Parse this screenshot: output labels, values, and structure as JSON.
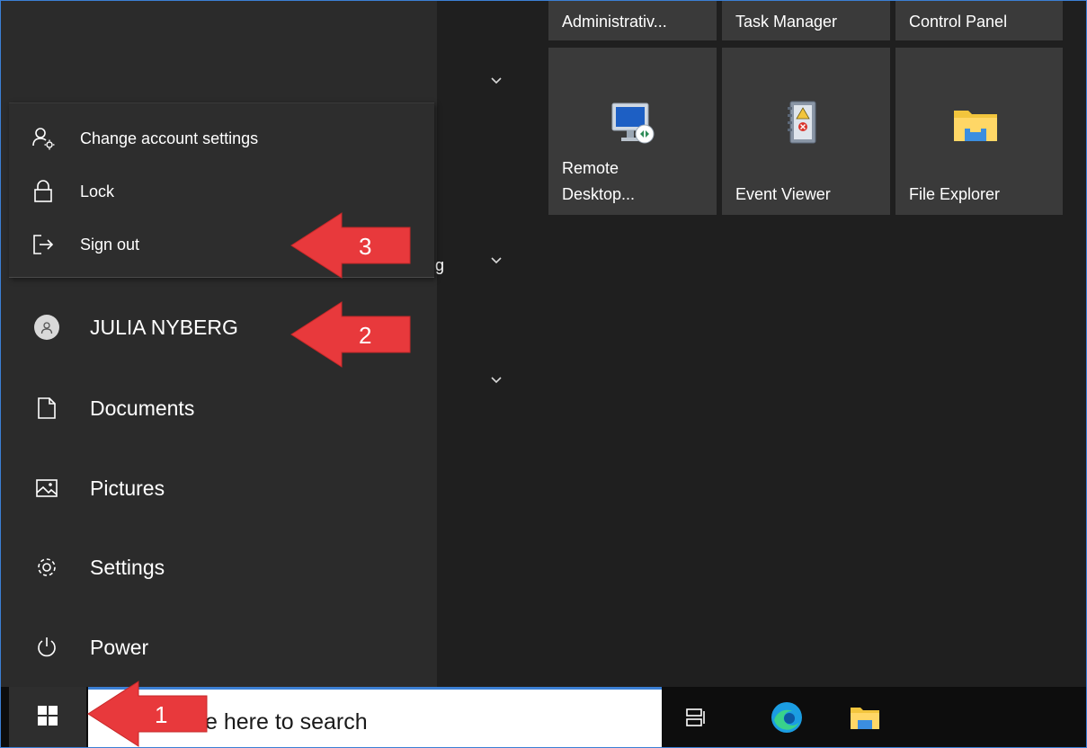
{
  "tiles": [
    {
      "label": "Administrativ...",
      "icon": "admin-tools-icon"
    },
    {
      "label": "Task Manager",
      "icon": "task-manager-icon"
    },
    {
      "label": "Control Panel",
      "icon": "control-panel-icon"
    },
    {
      "label_line1": "Remote",
      "label_line2": "Desktop...",
      "icon": "remote-desktop-icon"
    },
    {
      "label": "Event Viewer",
      "icon": "event-viewer-icon"
    },
    {
      "label": "File Explorer",
      "icon": "folder-icon"
    }
  ],
  "account_menu": {
    "items": [
      {
        "label": "Change account settings",
        "icon": "account-settings-icon"
      },
      {
        "label": "Lock",
        "icon": "lock-icon"
      },
      {
        "label": "Sign out",
        "icon": "sign-out-icon"
      }
    ]
  },
  "rail": {
    "user_name": "JULIA NYBERG",
    "items": [
      {
        "label": "Documents",
        "icon": "document-icon"
      },
      {
        "label": "Pictures",
        "icon": "pictures-icon"
      },
      {
        "label": "Settings",
        "icon": "gear-icon"
      },
      {
        "label": "Power",
        "icon": "power-icon"
      }
    ]
  },
  "list_fragment": "g",
  "taskbar": {
    "search_placeholder": "e here to search",
    "icons": [
      "windows-logo-icon",
      "task-view-icon",
      "edge-icon",
      "file-explorer-icon"
    ]
  },
  "callouts": [
    {
      "number": "1",
      "target": "start-button"
    },
    {
      "number": "2",
      "target": "user-name"
    },
    {
      "number": "3",
      "target": "sign-out"
    }
  ],
  "colors": {
    "callout_red": "#e8393c",
    "accent_blue": "#3b7fd4",
    "tile_bg": "#3a3a3a",
    "folder_yellow": "#f2c53d"
  }
}
